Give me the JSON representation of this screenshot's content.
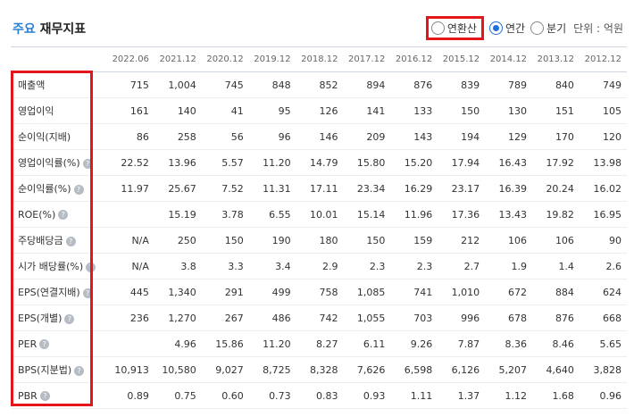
{
  "header": {
    "title_accent": "주요",
    "title_main": "재무지표",
    "options": [
      {
        "label": "연환산",
        "checked": false
      },
      {
        "label": "연간",
        "checked": true
      },
      {
        "label": "분기",
        "checked": false
      }
    ],
    "unit": "단위 : 억원"
  },
  "table": {
    "columns": [
      "2022.06",
      "2021.12",
      "2020.12",
      "2019.12",
      "2018.12",
      "2017.12",
      "2016.12",
      "2015.12",
      "2014.12",
      "2013.12",
      "2012.12"
    ],
    "rows": [
      {
        "label": "매출액",
        "info": false,
        "values": [
          "715",
          "1,004",
          "745",
          "848",
          "852",
          "894",
          "876",
          "839",
          "789",
          "840",
          "749"
        ]
      },
      {
        "label": "영업이익",
        "info": false,
        "values": [
          "161",
          "140",
          "41",
          "95",
          "126",
          "141",
          "133",
          "150",
          "130",
          "151",
          "105"
        ]
      },
      {
        "label": "순이익(지배)",
        "info": false,
        "values": [
          "86",
          "258",
          "56",
          "96",
          "146",
          "209",
          "143",
          "194",
          "129",
          "170",
          "120"
        ]
      },
      {
        "label": "영업이익률(%)",
        "info": true,
        "values": [
          "22.52",
          "13.96",
          "5.57",
          "11.20",
          "14.79",
          "15.80",
          "15.20",
          "17.94",
          "16.43",
          "17.92",
          "13.98"
        ]
      },
      {
        "label": "순이익률(%)",
        "info": true,
        "values": [
          "11.97",
          "25.67",
          "7.52",
          "11.31",
          "17.11",
          "23.34",
          "16.29",
          "23.17",
          "16.39",
          "20.24",
          "16.02"
        ]
      },
      {
        "label": "ROE(%)",
        "info": true,
        "values": [
          "",
          "15.19",
          "3.78",
          "6.55",
          "10.01",
          "15.14",
          "11.96",
          "17.36",
          "13.43",
          "19.82",
          "16.95"
        ]
      },
      {
        "label": "주당배당금",
        "info": true,
        "values": [
          "N/A",
          "250",
          "150",
          "190",
          "180",
          "150",
          "159",
          "212",
          "106",
          "106",
          "90"
        ]
      },
      {
        "label": "시가 배당률(%)",
        "info": true,
        "values": [
          "N/A",
          "3.8",
          "3.3",
          "3.4",
          "2.9",
          "2.3",
          "2.3",
          "2.7",
          "1.9",
          "1.4",
          "2.6"
        ]
      },
      {
        "label": "EPS(연결지배)",
        "info": true,
        "values": [
          "445",
          "1,340",
          "291",
          "499",
          "758",
          "1,085",
          "741",
          "1,010",
          "672",
          "884",
          "624"
        ]
      },
      {
        "label": "EPS(개별)",
        "info": true,
        "values": [
          "236",
          "1,270",
          "267",
          "486",
          "742",
          "1,055",
          "703",
          "996",
          "678",
          "876",
          "668"
        ]
      },
      {
        "label": "PER",
        "info": true,
        "values": [
          "",
          "4.96",
          "15.86",
          "11.20",
          "8.27",
          "6.11",
          "9.26",
          "7.87",
          "8.36",
          "8.46",
          "5.65"
        ]
      },
      {
        "label": "BPS(지분법)",
        "info": true,
        "values": [
          "10,913",
          "10,580",
          "9,027",
          "8,725",
          "8,328",
          "7,626",
          "6,598",
          "6,126",
          "5,207",
          "4,640",
          "3,828"
        ]
      },
      {
        "label": "PBR",
        "info": true,
        "values": [
          "0.89",
          "0.75",
          "0.60",
          "0.73",
          "0.83",
          "0.93",
          "1.11",
          "1.37",
          "1.12",
          "1.68",
          "0.96"
        ]
      }
    ]
  },
  "colors": {
    "accent": "#2a7fd4",
    "highlight": "#e2161b",
    "radio": "#1f6fd6"
  }
}
